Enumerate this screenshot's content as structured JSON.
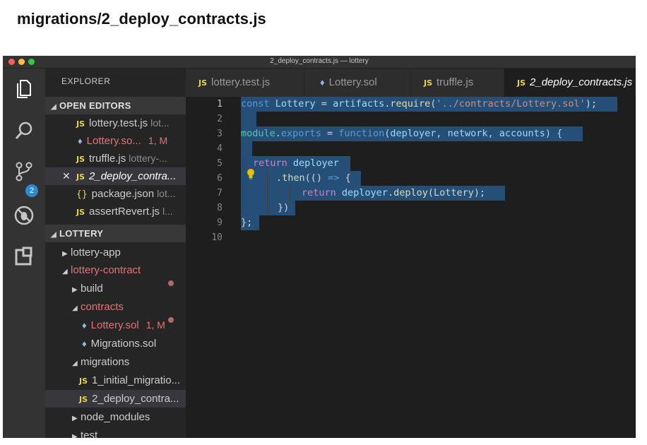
{
  "page_heading": "migrations/2_deploy_contracts.js",
  "window": {
    "title": "2_deploy_contracts.js — lottery"
  },
  "activity_bar": {
    "icons": [
      "files-icon",
      "search-icon",
      "source-control-icon",
      "debug-icon",
      "extensions-icon"
    ],
    "scm_badge": "2"
  },
  "explorer": {
    "title": "EXPLORER",
    "open_editors_label": "OPEN EDITORS",
    "open_editors": [
      {
        "icon": "JS",
        "name": "lottery.test.js",
        "hint": "lot..."
      },
      {
        "icon": "eth",
        "name": "Lottery.so...",
        "badge": "1, M"
      },
      {
        "icon": "JS",
        "name": "truffle.js",
        "hint": "lottery-..."
      },
      {
        "icon": "JS",
        "name": "2_deploy_contra...",
        "active": true
      },
      {
        "icon": "{}",
        "name": "package.json",
        "hint": "lot..."
      },
      {
        "icon": "JS",
        "name": "assertRevert.js",
        "hint": "l..."
      }
    ],
    "folder_label": "LOTTERY",
    "tree": {
      "lottery_app": "lottery-app",
      "lottery_contract": "lottery-contract",
      "build": "build",
      "contracts": "contracts",
      "lottery_sol": "Lottery.sol",
      "lottery_sol_badge": "1, M",
      "migrations_sol": "Migrations.sol",
      "migrations": "migrations",
      "initial_migration": "1_initial_migratio...",
      "deploy_contracts": "2_deploy_contra...",
      "node_modules": "node_modules",
      "test": "test"
    }
  },
  "tabs": [
    {
      "icon": "JS",
      "label": "lottery.test.js"
    },
    {
      "icon": "eth",
      "label": "Lottery.sol"
    },
    {
      "icon": "JS",
      "label": "truffle.js"
    },
    {
      "icon": "JS",
      "label": "2_deploy_contracts.js",
      "active": true
    }
  ],
  "editor": {
    "line_numbers": [
      "1",
      "2",
      "3",
      "4",
      "5",
      "6",
      "7",
      "8",
      "9",
      "10"
    ],
    "lines": {
      "l1": {
        "kw": "const",
        "name": " Lottery",
        "eq": " = ",
        "obj": "artifacts",
        "dot": ".",
        "fn": "require",
        "open": "(",
        "str": "'../contracts/Lottery.sol'",
        "close": ");"
      },
      "l3": {
        "mod": "module",
        "dot": ".",
        "exp": "exports",
        "eq": " = ",
        "kw": "function",
        "params": "(deployer, network, accounts) {"
      },
      "l5": {
        "ret": "return",
        "name": " deployer"
      },
      "l6": {
        "dot": ".",
        "fn": "then",
        "args": "(() ",
        "arrow": "=>",
        "brace": " {"
      },
      "l7": {
        "ret": "return",
        "obj": " deployer",
        "dot": ".",
        "fn": "deploy",
        "args": "(Lottery);"
      },
      "l8": {
        "close": "})"
      },
      "l9": {
        "close": "};"
      }
    }
  },
  "colors": {
    "selection": "#264f78",
    "keyword": "#569cd6",
    "string": "#ce9178",
    "function": "#dcdcaa",
    "js_icon": "#e8d44d",
    "modified": "#e57373"
  }
}
